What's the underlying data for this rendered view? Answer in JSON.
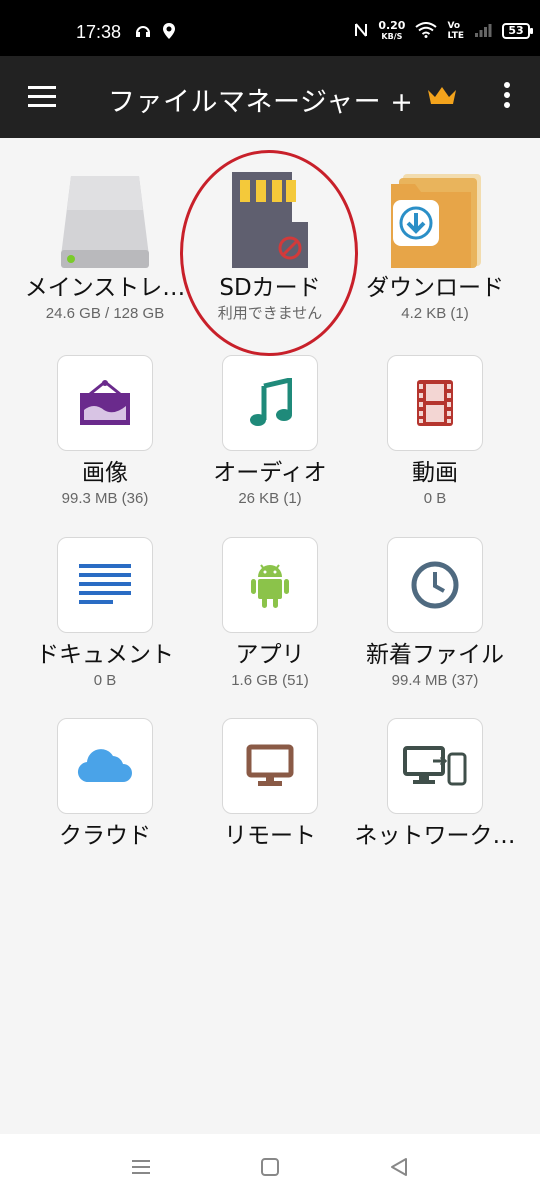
{
  "status_bar": {
    "time": "17:38",
    "net_speed_value": "0.20",
    "net_speed_unit": "KB/S",
    "volte_top": "Vo",
    "volte_bottom": "LTE",
    "battery": "53"
  },
  "app_bar": {
    "title": "ファイルマネージャー +",
    "crown_color": "#f3a31c"
  },
  "tiles": [
    {
      "label": "メインストレ…",
      "sub": "24.6 GB / 128 GB",
      "icon": "hard-drive-icon"
    },
    {
      "label": "SDカード",
      "sub": "利用できません",
      "icon": "sd-card-icon"
    },
    {
      "label": "ダウンロード",
      "sub": "4.2 KB (1)",
      "icon": "download-folder-icon"
    },
    {
      "label": "画像",
      "sub": "99.3 MB (36)",
      "icon": "image-icon"
    },
    {
      "label": "オーディオ",
      "sub": "26 KB (1)",
      "icon": "music-note-icon"
    },
    {
      "label": "動画",
      "sub": "0 B",
      "icon": "film-icon"
    },
    {
      "label": "ドキュメント",
      "sub": "0 B",
      "icon": "document-icon"
    },
    {
      "label": "アプリ",
      "sub": "1.6 GB (51)",
      "icon": "android-icon"
    },
    {
      "label": "新着ファイル",
      "sub": "99.4 MB (37)",
      "icon": "clock-icon"
    },
    {
      "label": "クラウド",
      "sub": "",
      "icon": "cloud-icon"
    },
    {
      "label": "リモート",
      "sub": "",
      "icon": "monitor-icon"
    },
    {
      "label": "ネットワーク…",
      "sub": "",
      "icon": "network-devices-icon"
    }
  ],
  "colors": {
    "image": "#6a2a8c",
    "audio": "#1f8a7a",
    "video": "#b5352e",
    "document": "#2a6cc4",
    "android": "#8bc34a",
    "clock": "#4f6a80",
    "cloud": "#4aa3e8",
    "remote": "#8a5a46",
    "network": "#3f4f4a",
    "highlight": "#c8202a"
  }
}
